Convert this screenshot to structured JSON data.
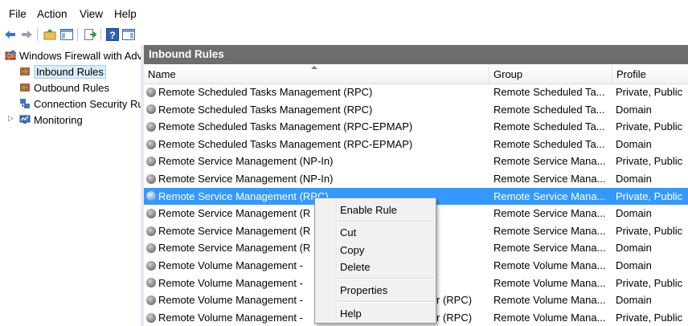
{
  "menu": [
    "File",
    "Action",
    "View",
    "Help"
  ],
  "toolbar": {
    "icons": [
      "back-arrow-icon",
      "forward-arrow-icon",
      "up-folder-icon",
      "show-hide-tree-icon",
      "export-list-icon",
      "help-icon",
      "show-hide-action-pane-icon"
    ]
  },
  "tree": {
    "root": "Windows Firewall with Advanced Security",
    "items": [
      {
        "label": "Inbound Rules",
        "selected": true
      },
      {
        "label": "Outbound Rules",
        "selected": false
      },
      {
        "label": "Connection Security Rules",
        "selected": false
      },
      {
        "label": "Monitoring",
        "selected": false
      }
    ]
  },
  "pane": {
    "title": "Inbound Rules",
    "columns": {
      "name": "Name",
      "group": "Group",
      "profile": "Profile"
    }
  },
  "rules": [
    {
      "name": "Remote Scheduled Tasks Management (RPC)",
      "group": "Remote Scheduled Ta...",
      "profile": "Private, Public"
    },
    {
      "name": "Remote Scheduled Tasks Management (RPC)",
      "group": "Remote Scheduled Ta...",
      "profile": "Domain"
    },
    {
      "name": "Remote Scheduled Tasks Management (RPC-EPMAP)",
      "group": "Remote Scheduled Ta...",
      "profile": "Private, Public"
    },
    {
      "name": "Remote Scheduled Tasks Management (RPC-EPMAP)",
      "group": "Remote Scheduled Ta...",
      "profile": "Domain"
    },
    {
      "name": "Remote Service Management (NP-In)",
      "group": "Remote Service Mana...",
      "profile": "Private, Public"
    },
    {
      "name": "Remote Service Management (NP-In)",
      "group": "Remote Service Mana...",
      "profile": "Domain"
    },
    {
      "name": "Remote Service Management (RPC)",
      "group": "Remote Service Mana...",
      "profile": "Private, Public"
    },
    {
      "name": "Remote Service Management (R",
      "group": "Remote Service Mana...",
      "profile": "Domain"
    },
    {
      "name": "Remote Service Management (R",
      "group": "Remote Service Mana...",
      "profile": "Private, Public"
    },
    {
      "name": "Remote Service Management (R",
      "group": "Remote Service Mana...",
      "profile": "Domain"
    },
    {
      "name": "Remote Volume Management -",
      "group": "Remote Volume Mana...",
      "profile": "Domain"
    },
    {
      "name": "Remote Volume Management -",
      "group": "Remote Volume Mana...",
      "profile": "Private, Public"
    },
    {
      "name": "Remote Volume Management -",
      "tail": "r (RPC)",
      "group": "Remote Volume Mana...",
      "profile": "Domain"
    },
    {
      "name": "Remote Volume Management -",
      "tail": "r (RPC)",
      "group": "Remote Volume Mana...",
      "profile": "Private, Public"
    }
  ],
  "selected_row": 6,
  "context_menu": {
    "items": [
      "Enable Rule",
      "Cut",
      "Copy",
      "Delete",
      "Properties",
      "Help"
    ]
  },
  "colors": {
    "selection": "#3399ff",
    "pane_title": "#6d6d6d",
    "tree_selection": "#d9ebf9"
  }
}
